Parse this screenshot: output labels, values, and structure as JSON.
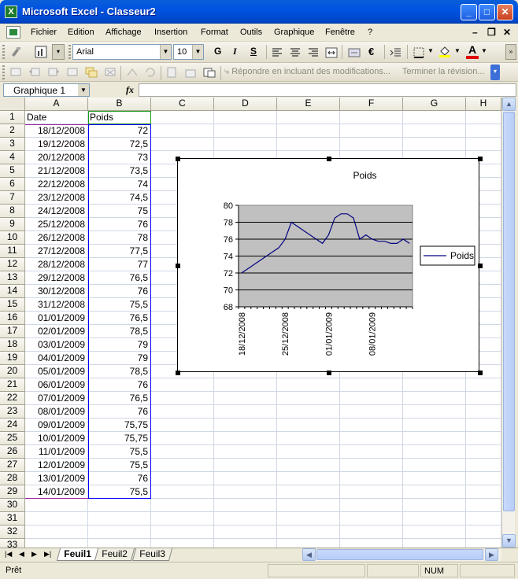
{
  "window": {
    "title": "Microsoft Excel - Classeur2",
    "min_label": "_",
    "max_label": "□",
    "close_label": "✕",
    "app_icon": "X"
  },
  "menu": {
    "items": [
      "Fichier",
      "Edition",
      "Affichage",
      "Insertion",
      "Format",
      "Outils",
      "Graphique",
      "Fenêtre",
      "?"
    ],
    "mdi_min": "–",
    "mdi_restore": "❐",
    "mdi_close": "✕"
  },
  "toolbar": {
    "font_name": "Arial",
    "font_size": "10",
    "bold": "G",
    "italic": "I",
    "underline": "S",
    "currency": "€",
    "reply_text": "Répondre en incluant des modifications...",
    "end_review": "Terminer la révision..."
  },
  "namebox": {
    "value": "Graphique 1",
    "fx": "fx"
  },
  "grid": {
    "columns": [
      "A",
      "B",
      "C",
      "D",
      "E",
      "F",
      "G",
      "H"
    ],
    "rows": [
      "1",
      "2",
      "3",
      "4",
      "5",
      "6",
      "7",
      "8",
      "9",
      "10",
      "11",
      "12",
      "13",
      "14",
      "15",
      "16",
      "17",
      "18",
      "19",
      "20",
      "21",
      "22",
      "23",
      "24",
      "25",
      "26",
      "27",
      "28",
      "29",
      "30",
      "31",
      "32",
      "33"
    ],
    "header_row": [
      "Date",
      "Poids"
    ],
    "data": [
      [
        "18/12/2008",
        "72"
      ],
      [
        "19/12/2008",
        "72,5"
      ],
      [
        "20/12/2008",
        "73"
      ],
      [
        "21/12/2008",
        "73,5"
      ],
      [
        "22/12/2008",
        "74"
      ],
      [
        "23/12/2008",
        "74,5"
      ],
      [
        "24/12/2008",
        "75"
      ],
      [
        "25/12/2008",
        "76"
      ],
      [
        "26/12/2008",
        "78"
      ],
      [
        "27/12/2008",
        "77,5"
      ],
      [
        "28/12/2008",
        "77"
      ],
      [
        "29/12/2008",
        "76,5"
      ],
      [
        "30/12/2008",
        "76"
      ],
      [
        "31/12/2008",
        "75,5"
      ],
      [
        "01/01/2009",
        "76,5"
      ],
      [
        "02/01/2009",
        "78,5"
      ],
      [
        "03/01/2009",
        "79"
      ],
      [
        "04/01/2009",
        "79"
      ],
      [
        "05/01/2009",
        "78,5"
      ],
      [
        "06/01/2009",
        "76"
      ],
      [
        "07/01/2009",
        "76,5"
      ],
      [
        "08/01/2009",
        "76"
      ],
      [
        "09/01/2009",
        "75,75"
      ],
      [
        "10/01/2009",
        "75,75"
      ],
      [
        "11/01/2009",
        "75,5"
      ],
      [
        "12/01/2009",
        "75,5"
      ],
      [
        "13/01/2009",
        "76"
      ],
      [
        "14/01/2009",
        "75,5"
      ]
    ]
  },
  "chart_data": {
    "type": "line",
    "title": "Poids",
    "x": [
      "18/12/2008",
      "19/12/2008",
      "20/12/2008",
      "21/12/2008",
      "22/12/2008",
      "23/12/2008",
      "24/12/2008",
      "25/12/2008",
      "26/12/2008",
      "27/12/2008",
      "28/12/2008",
      "29/12/2008",
      "30/12/2008",
      "31/12/2008",
      "01/01/2009",
      "02/01/2009",
      "03/01/2009",
      "04/01/2009",
      "05/01/2009",
      "06/01/2009",
      "07/01/2009",
      "08/01/2009",
      "09/01/2009",
      "10/01/2009",
      "11/01/2009",
      "12/01/2009",
      "13/01/2009",
      "14/01/2009"
    ],
    "series": [
      {
        "name": "Poids",
        "values": [
          72,
          72.5,
          73,
          73.5,
          74,
          74.5,
          75,
          76,
          78,
          77.5,
          77,
          76.5,
          76,
          75.5,
          76.5,
          78.5,
          79,
          79,
          78.5,
          76,
          76.5,
          76,
          75.75,
          75.75,
          75.5,
          75.5,
          76,
          75.5
        ]
      }
    ],
    "ylim": [
      68,
      80
    ],
    "yticks": [
      "68",
      "70",
      "72",
      "74",
      "76",
      "78",
      "80"
    ],
    "xticks": [
      "18/12/2008",
      "25/12/2008",
      "01/01/2009",
      "08/01/2009"
    ],
    "legend_position": "right",
    "grid": true,
    "plot_bg": "#c0c0c0"
  },
  "tabs": {
    "nav": [
      "|◀",
      "◀",
      "▶",
      "▶|"
    ],
    "sheets": [
      "Feuil1",
      "Feuil2",
      "Feuil3"
    ],
    "active": "Feuil1"
  },
  "status": {
    "ready": "Prêt",
    "num": "NUM"
  },
  "colors": {
    "title_bar": "#0053e1",
    "grid_line": "#d0d7e5",
    "selection_border": "#0000ff"
  }
}
